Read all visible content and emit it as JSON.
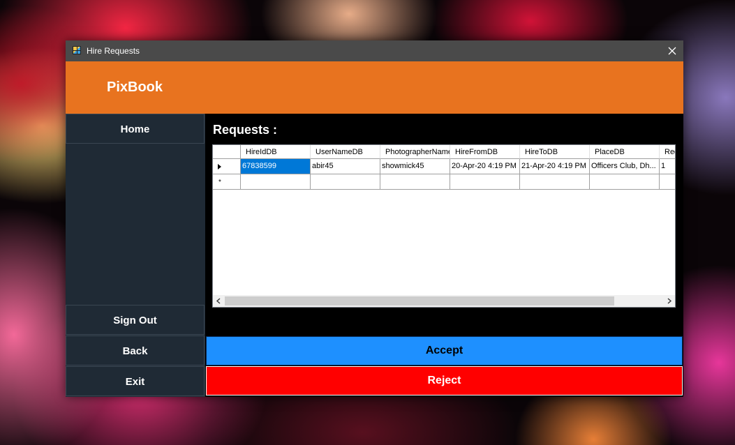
{
  "window": {
    "title": "Hire Requests"
  },
  "header": {
    "brand": "PixBook"
  },
  "sidebar": {
    "home": "Home",
    "sign_out": "Sign Out",
    "back": "Back",
    "exit": "Exit"
  },
  "content": {
    "title": "Requests :"
  },
  "grid": {
    "columns": [
      "HireIdDB",
      "UserNameDB",
      "PhotographerName",
      "HireFromDB",
      "HireToDB",
      "PlaceDB",
      "Req"
    ],
    "rows": [
      [
        "67838599",
        "abir45",
        "showmick45",
        "20-Apr-20 4:19 PM",
        "21-Apr-20 4:19 PM",
        "Officers Club, Dh...",
        "1"
      ]
    ],
    "new_row_marker": "*"
  },
  "actions": {
    "accept": "Accept",
    "reject": "Reject"
  },
  "colors": {
    "header": "#e8731f",
    "sidebar": "#1f2a35",
    "accept": "#1e90ff",
    "reject": "#ff0000",
    "selection": "#0078d7"
  }
}
